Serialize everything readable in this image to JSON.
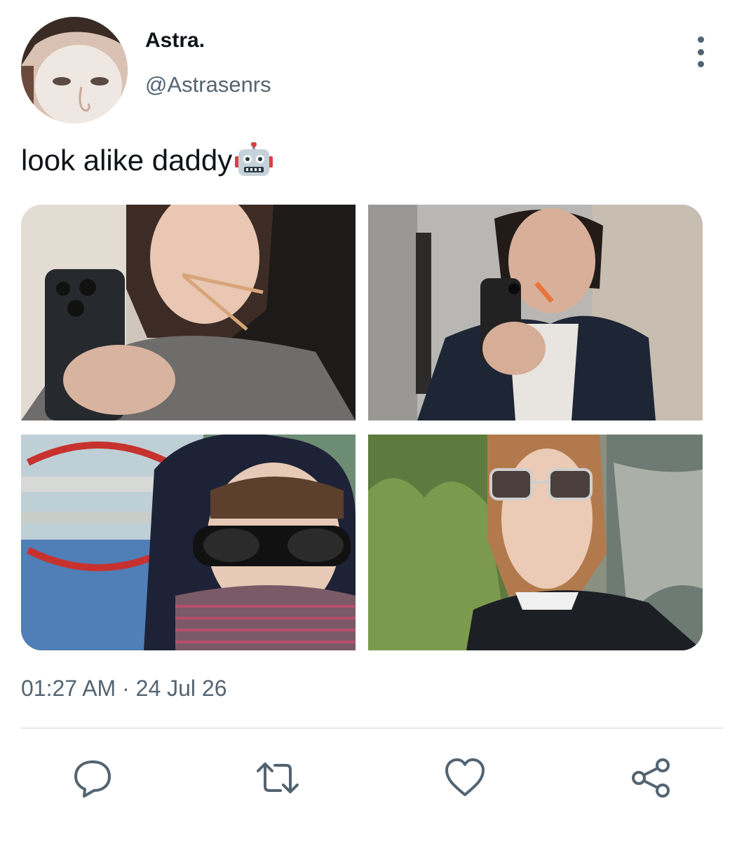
{
  "tweet": {
    "author": {
      "display_name": "Astra.",
      "handle": "@Astrasenrs",
      "avatar": "avatar-face-mask-photo"
    },
    "text": "look alike daddy",
    "emoji": "robot-emoji",
    "media": [
      {
        "name": "mirror-selfie-chopsticks"
      },
      {
        "name": "mirror-selfie-jacket"
      },
      {
        "name": "selfie-hood-sunglasses-bridge"
      },
      {
        "name": "selfie-sunglasses-river"
      }
    ],
    "timestamp": "01:27 AM · 24 Jul 26"
  },
  "actions": {
    "more": "more-options-icon",
    "reply": "reply-icon",
    "retweet": "retweet-icon",
    "like": "heart-icon",
    "share": "share-icon"
  },
  "colors": {
    "text_primary": "#0f1419",
    "text_secondary": "#536471",
    "divider": "#e3e7ea"
  }
}
